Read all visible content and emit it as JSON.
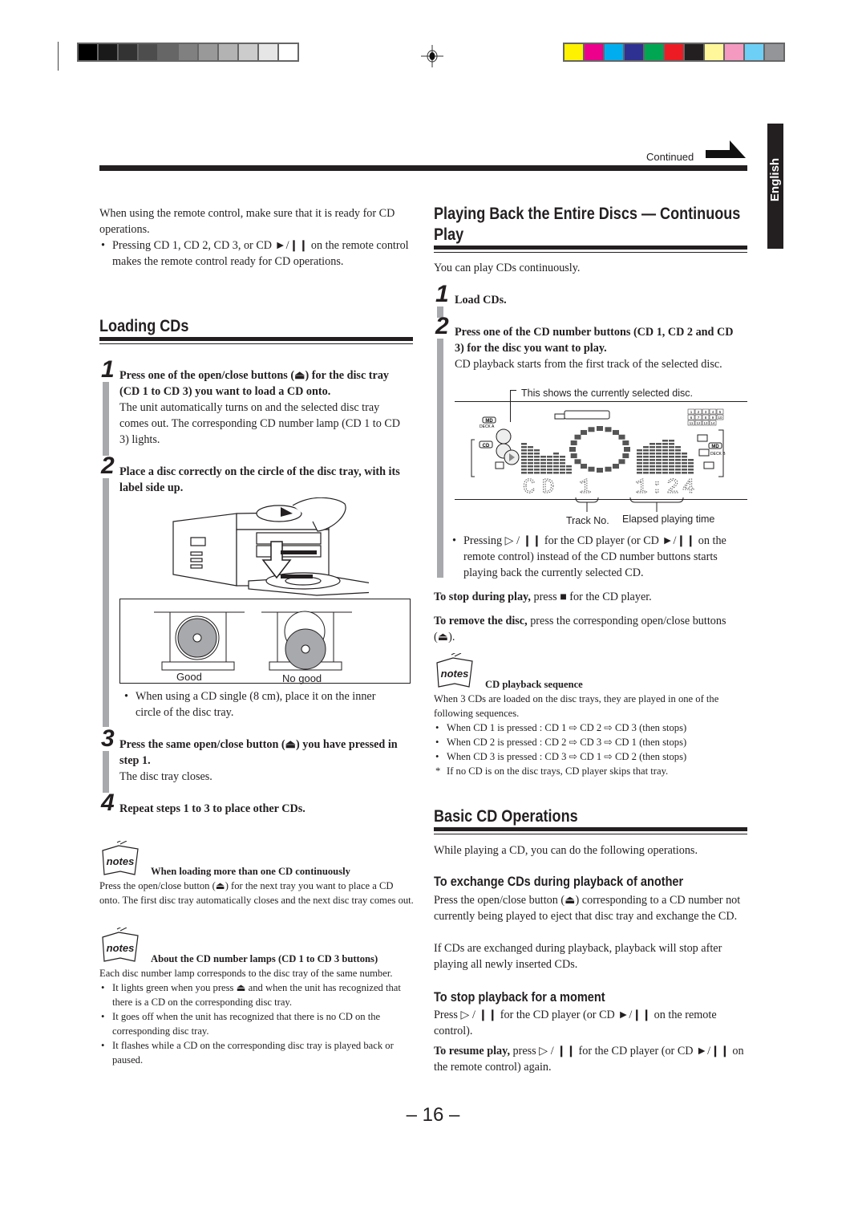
{
  "header": {
    "continued_label": "Continued",
    "language_tab": "English",
    "grayscale_swatches": [
      "#000000",
      "#1a1a1a",
      "#333333",
      "#4d4d4d",
      "#666666",
      "#808080",
      "#999999",
      "#b3b3b3",
      "#cccccc",
      "#e6e6e6",
      "#ffffff"
    ],
    "color_swatches": [
      "#fff200",
      "#ec008c",
      "#00aeef",
      "#2e3192",
      "#00a651",
      "#ed1c24",
      "#231f20",
      "#fff799",
      "#f49ac1",
      "#6dcff6",
      "#939598"
    ]
  },
  "left": {
    "intro": "When using the remote control, make sure that it is ready for CD operations.",
    "intro_bullet": "Pressing CD 1, CD 2, CD 3, or CD ►/❙❙ on the remote control makes the remote control ready for CD operations.",
    "loading": {
      "title": "Loading CDs",
      "steps": [
        {
          "num": "1",
          "bold": "Press one of the open/close buttons (⏏) for the disc tray (CD 1 to CD 3) you want to load a CD onto.",
          "text": "The unit automatically turns on and the selected disc tray comes out. The corresponding CD number lamp (CD 1 to CD 3) lights."
        },
        {
          "num": "2",
          "bold": "Place a disc correctly on the circle of the disc tray, with its label side up.",
          "text": ""
        },
        {
          "num": "3",
          "bold": "Press the same open/close button (⏏) you have pressed in step 1.",
          "text": "The disc tray closes."
        },
        {
          "num": "4",
          "bold": "Repeat steps 1 to 3 to place other CDs.",
          "text": ""
        }
      ],
      "figure_labels": {
        "good": "Good",
        "no_good": "No good"
      },
      "step2_bullet": "When using a CD single (8 cm), place it on the inner circle of the disc tray."
    },
    "notes": [
      {
        "icon_label": "notes",
        "title": "When loading more than one CD continuously",
        "body": "Press the open/close button (⏏) for the next tray you want to place a CD onto. The first disc tray automatically closes and the next disc tray comes out.",
        "bullets": []
      },
      {
        "icon_label": "notes",
        "title": "About the CD number lamps (CD 1 to CD 3 buttons)",
        "body": "Each disc number lamp corresponds to the disc tray of the same number.",
        "bullets": [
          "It lights green when you press ⏏ and when the unit has recognized that there is a CD on the corresponding disc tray.",
          "It goes off  when the unit has recognized that there is no CD on the corresponding disc tray.",
          "It flashes while a CD on the corresponding disc tray is played back or paused."
        ]
      }
    ]
  },
  "right": {
    "continuous": {
      "title": "Playing Back the Entire Discs — Continuous Play",
      "intro": "You can play CDs continuously.",
      "steps": [
        {
          "num": "1",
          "bold": "Load CDs.",
          "text": ""
        },
        {
          "num": "2",
          "bold": "Press one of the CD number buttons (CD 1, CD 2 and CD 3) for the disc you want to play.",
          "text": "CD playback starts from the first track of the selected disc."
        }
      ],
      "display": {
        "callout_top": "This shows the currently selected disc.",
        "lcd_source": "CD",
        "lcd_track": "1",
        "lcd_time": "1:24",
        "callout_track": "Track No.",
        "callout_time": "Elapsed playing time",
        "deck_a": "DECK A",
        "deck_b": "DECK B",
        "md": "MD",
        "cd": "CD",
        "track_grid": [
          "1",
          "2",
          "3",
          "4",
          "5",
          "6",
          "7",
          "8",
          "9",
          "10",
          "11",
          "12",
          "13",
          "14"
        ]
      },
      "bullet": "Pressing ▷ / ❙❙ for the CD player (or CD ►/❙❙ on the remote control) instead of the CD number buttons starts playing back the currently selected CD.",
      "stop_bold": "To stop during play,",
      "stop_text": " press ■ for the CD player.",
      "remove_bold": "To remove the disc,",
      "remove_text": " press the corresponding open/close buttons (⏏).",
      "note": {
        "icon_label": "notes",
        "title": "CD playback sequence",
        "body": "When 3 CDs are loaded on the disc trays, they are played in one of the following sequences.",
        "bullets": [
          "When CD 1 is pressed : CD 1 ⇨ CD 2 ⇨ CD 3 (then stops)",
          "When CD 2 is pressed : CD 2 ⇨ CD 3 ⇨ CD 1 (then stops)",
          "When CD 3 is pressed : CD 3 ⇨ CD 1 ⇨ CD 2 (then stops)"
        ],
        "footnote": "If no CD is on the disc trays, CD player skips that tray."
      }
    },
    "basic": {
      "title": "Basic CD Operations",
      "intro": "While playing a CD, you can do the following operations.",
      "exchange_title": "To exchange CDs during playback of another",
      "exchange_text": "Press the open/close button (⏏) corresponding to a CD number not currently being played to eject that disc tray and exchange the CD.",
      "exchange_text2": "If CDs are exchanged during playback, playback will stop after playing all newly inserted CDs.",
      "pause_title": "To stop playback for a moment",
      "pause_text": "Press ▷ / ❙❙ for the CD player (or CD ►/❙❙ on the remote control).",
      "resume_bold": "To resume play,",
      "resume_text": " press ▷ / ❙❙ for the CD player (or CD ►/❙❙ on the remote control) again."
    }
  },
  "footer": {
    "page_number": "– 16 –"
  }
}
